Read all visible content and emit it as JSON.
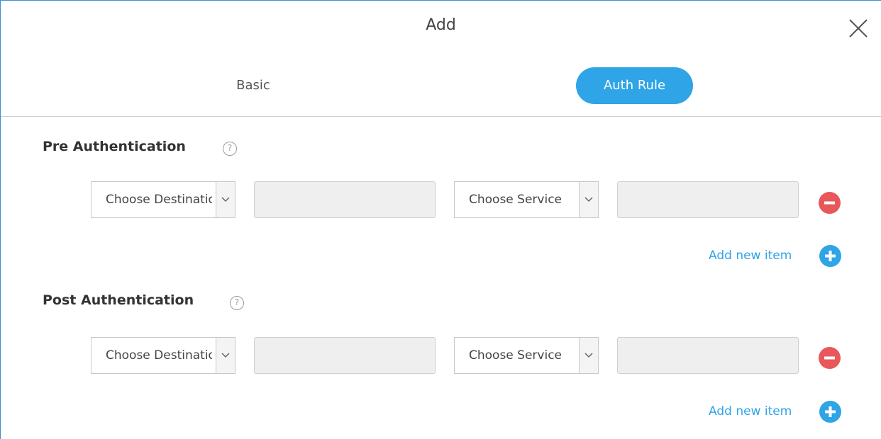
{
  "dialog": {
    "title": "Add",
    "close_label": "close"
  },
  "tabs": [
    {
      "label": "Basic",
      "active": false
    },
    {
      "label": "Auth Rule",
      "active": true
    }
  ],
  "colors": {
    "accent": "#2fa4e7",
    "remove": "#e8585a",
    "input_bg": "#efefef"
  },
  "sections": [
    {
      "title": "Pre Authentication",
      "help_icon": "question-circle-icon",
      "row": {
        "destination_select": "Choose Destination",
        "destination_value": "",
        "service_select": "Choose Service",
        "service_value": ""
      },
      "add_label": "Add new item"
    },
    {
      "title": "Post Authentication",
      "help_icon": "question-circle-icon",
      "row": {
        "destination_select": "Choose Destination",
        "destination_value": "",
        "service_select": "Choose Service",
        "service_value": ""
      },
      "add_label": "Add new item"
    }
  ]
}
